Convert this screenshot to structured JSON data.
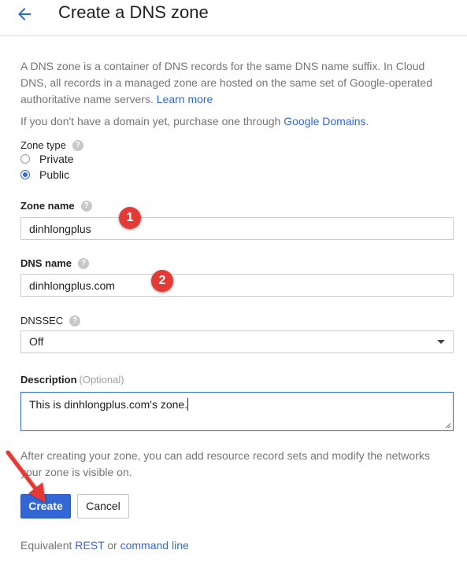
{
  "header": {
    "back_icon": "arrow-back-icon",
    "title": "Create a DNS zone"
  },
  "intro": {
    "text": "A DNS zone is a container of DNS records for the same DNS name suffix. In Cloud DNS, all records in a managed zone are hosted on the same set of Google-operated authoritative name servers.",
    "learn_more": "Learn more"
  },
  "purchase": {
    "text": "If you don't have a domain yet, purchase one through",
    "link": "Google Domains",
    "suffix": "."
  },
  "zone_type": {
    "label": "Zone type",
    "options": [
      {
        "label": "Private",
        "selected": false
      },
      {
        "label": "Public",
        "selected": true
      }
    ]
  },
  "zone_name": {
    "label": "Zone name",
    "value": "dinhlongplus"
  },
  "dns_name": {
    "label": "DNS name",
    "value": "dinhlongplus.com"
  },
  "dnssec": {
    "label": "DNSSEC",
    "selected": "Off"
  },
  "description": {
    "label": "Description",
    "optional": "(Optional)",
    "value": "This is dinhlongplus.com's zone."
  },
  "after_text": "After creating your zone, you can add resource record sets and modify the networks your zone is visible on.",
  "buttons": {
    "create": "Create",
    "cancel": "Cancel"
  },
  "equivalent": {
    "prefix": "Equivalent",
    "rest": "REST",
    "or": "or",
    "command_line": "command line"
  },
  "annotations": {
    "marker_1": "1",
    "marker_2": "2",
    "marker_color": "#e53935"
  },
  "colors": {
    "accent": "#3367d6",
    "help_icon": "#c8c8c8"
  }
}
